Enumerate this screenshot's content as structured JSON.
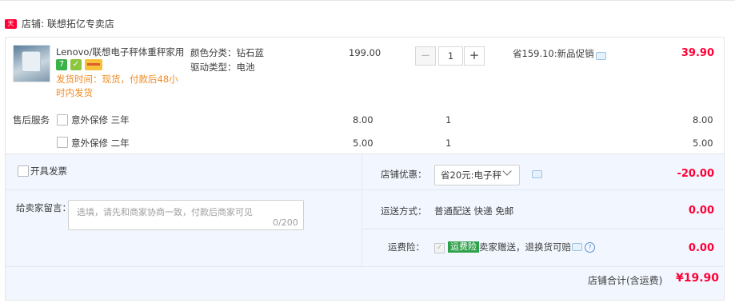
{
  "shop": {
    "badge": "天猫",
    "name": "店铺: 联想拓亿专卖店"
  },
  "item": {
    "title": "Lenovo/联想电子秤体重秤家用...",
    "sku_color": "颜色分类：钻石蓝",
    "sku_power": "驱动类型：电池",
    "delivery": "发货时间：现货，付款后48小时内发货",
    "icon_7": "7",
    "price": "199.00",
    "quantity": "1",
    "promo": "省159.10:新品促销",
    "subtotal": "39.90"
  },
  "service": {
    "label": "售后服务",
    "options": [
      {
        "name": "意外保修 三年",
        "price": "8.00",
        "qty": "1",
        "total": "8.00"
      },
      {
        "name": "意外保修 二年",
        "price": "5.00",
        "qty": "1",
        "total": "5.00"
      }
    ]
  },
  "invoice": {
    "label": "开具发票"
  },
  "message": {
    "label": "给卖家留言：",
    "placeholder": "选填，请先和商家协商一致，付款后商家可见",
    "count": "0/200"
  },
  "discount": {
    "label": "店铺优惠：",
    "selected": "省20元:电子秤",
    "value": "-20.00"
  },
  "shipping": {
    "label": "运送方式：",
    "value": "普通配送 快递 免邮",
    "fee": "0.00"
  },
  "insurance": {
    "label": "运费险：",
    "tag": "运费险",
    "desc": "卖家赠送，退换货可赔",
    "fee": "0.00"
  },
  "total": {
    "label": "店铺合计(含运费)",
    "value": "¥19.90"
  },
  "colors": {
    "price_red": "#ff0036",
    "orange": "#f08a24",
    "panel_bg": "#f2f7ff",
    "tmall_red": "#ff0036"
  }
}
